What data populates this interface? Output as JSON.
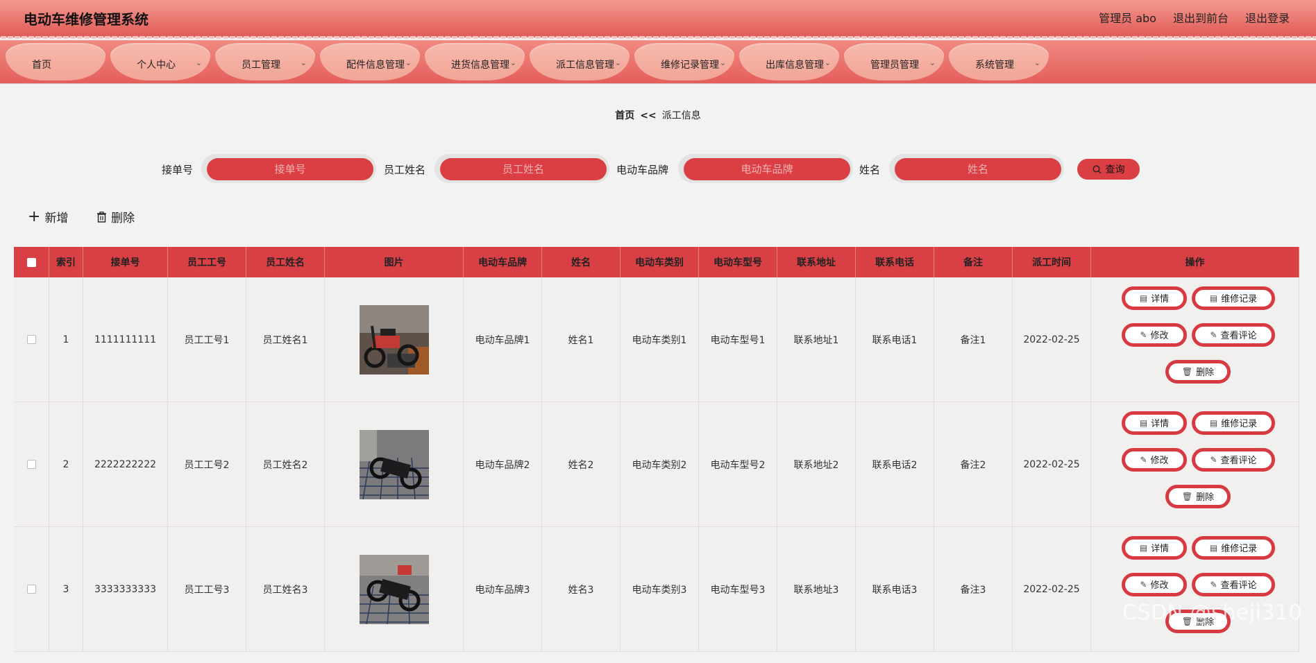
{
  "header": {
    "title": "电动车维修管理系统",
    "admin": "管理员 abo",
    "to_front": "退出到前台",
    "logout": "退出登录"
  },
  "nav": {
    "items": [
      {
        "label": "首页",
        "has_menu": false
      },
      {
        "label": "个人中心",
        "has_menu": true
      },
      {
        "label": "员工管理",
        "has_menu": true
      },
      {
        "label": "配件信息管理",
        "has_menu": true
      },
      {
        "label": "进货信息管理",
        "has_menu": true
      },
      {
        "label": "派工信息管理",
        "has_menu": true
      },
      {
        "label": "维修记录管理",
        "has_menu": true
      },
      {
        "label": "出库信息管理",
        "has_menu": true
      },
      {
        "label": "管理员管理",
        "has_menu": true
      },
      {
        "label": "系统管理",
        "has_menu": true
      }
    ]
  },
  "breadcrumb": {
    "home": "首页",
    "separator": "<<",
    "current": "派工信息"
  },
  "search": {
    "fields": [
      {
        "label": "接单号",
        "placeholder": "接单号",
        "value": ""
      },
      {
        "label": "员工姓名",
        "placeholder": "员工姓名",
        "value": ""
      },
      {
        "label": "电动车品牌",
        "placeholder": "电动车品牌",
        "value": ""
      },
      {
        "label": "姓名",
        "placeholder": "姓名",
        "value": ""
      }
    ],
    "query_label": "查询"
  },
  "toolbar": {
    "add_label": "新增",
    "delete_label": "删除"
  },
  "table": {
    "headers": [
      "索引",
      "接单号",
      "员工工号",
      "员工姓名",
      "图片",
      "电动车品牌",
      "姓名",
      "电动车类别",
      "电动车型号",
      "联系地址",
      "联系电话",
      "备注",
      "派工时间",
      "操作"
    ],
    "rows": [
      {
        "index": "1",
        "order_no": "1111111111",
        "emp_no": "员工工号1",
        "emp_name": "员工姓名1",
        "brand": "电动车品牌1",
        "name": "姓名1",
        "category": "电动车类别1",
        "model": "电动车型号1",
        "address": "联系地址1",
        "phone": "联系电话1",
        "note": "备注1",
        "time": "2022-02-25"
      },
      {
        "index": "2",
        "order_no": "2222222222",
        "emp_no": "员工工号2",
        "emp_name": "员工姓名2",
        "brand": "电动车品牌2",
        "name": "姓名2",
        "category": "电动车类别2",
        "model": "电动车型号2",
        "address": "联系地址2",
        "phone": "联系电话2",
        "note": "备注2",
        "time": "2022-02-25"
      },
      {
        "index": "3",
        "order_no": "3333333333",
        "emp_no": "员工工号3",
        "emp_name": "员工姓名3",
        "brand": "电动车品牌3",
        "name": "姓名3",
        "category": "电动车类别3",
        "model": "电动车型号3",
        "address": "联系地址3",
        "phone": "联系电话3",
        "note": "备注3",
        "time": "2022-02-25"
      }
    ],
    "actions": {
      "detail": "详情",
      "repair_record": "维修记录",
      "edit": "修改",
      "view_comments": "查看评论",
      "delete": "删除"
    }
  },
  "watermark": "CSDN @sheji310",
  "colors": {
    "accent": "#db3f44",
    "header_top": "#f49a90",
    "nav_item": "#f4ad9f",
    "table_bg": "#f2efef"
  }
}
